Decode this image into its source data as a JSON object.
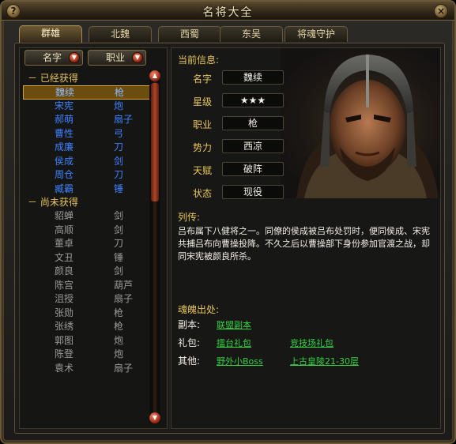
{
  "window": {
    "title": "名将大全"
  },
  "tabs": [
    {
      "label": "群雄",
      "active": true
    },
    {
      "label": "北魏",
      "active": false
    },
    {
      "label": "西蜀",
      "active": false
    },
    {
      "label": "东吴",
      "active": false
    },
    {
      "label": "将魂守护",
      "active": false
    }
  ],
  "sort": {
    "name_label": "名字",
    "job_label": "职业"
  },
  "list": {
    "owned_header": "已经获得",
    "owned": [
      {
        "name": "魏续",
        "weapon": "枪",
        "selected": true
      },
      {
        "name": "宋宪",
        "weapon": "炮"
      },
      {
        "name": "郝萌",
        "weapon": "扇子"
      },
      {
        "name": "曹性",
        "weapon": "弓"
      },
      {
        "name": "成廉",
        "weapon": "刀"
      },
      {
        "name": "侯成",
        "weapon": "剑"
      },
      {
        "name": "周仓",
        "weapon": "刀"
      },
      {
        "name": "臧霸",
        "weapon": "锤"
      }
    ],
    "not_owned_header": "尚未获得",
    "not_owned": [
      {
        "name": "貂蝉",
        "weapon": "剑"
      },
      {
        "name": "高顺",
        "weapon": "剑"
      },
      {
        "name": "董卓",
        "weapon": "刀"
      },
      {
        "name": "文丑",
        "weapon": "锤"
      },
      {
        "name": "颜良",
        "weapon": "剑"
      },
      {
        "name": "陈宫",
        "weapon": "葫芦"
      },
      {
        "name": "沮授",
        "weapon": "扇子"
      },
      {
        "name": "张勋",
        "weapon": "枪"
      },
      {
        "name": "张绣",
        "weapon": "枪"
      },
      {
        "name": "郭图",
        "weapon": "炮"
      },
      {
        "name": "陈登",
        "weapon": "炮"
      },
      {
        "name": "袁术",
        "weapon": "扇子"
      }
    ]
  },
  "info": {
    "current_label": "当前信息:",
    "attrs": [
      {
        "label": "名字",
        "value": "魏续"
      },
      {
        "label": "星级",
        "value": "★★★"
      },
      {
        "label": "职业",
        "value": "枪"
      },
      {
        "label": "势力",
        "value": "西凉"
      },
      {
        "label": "天赋",
        "value": "破阵"
      },
      {
        "label": "状态",
        "value": "现役"
      }
    ],
    "bio_label": "列传:",
    "bio": "吕布属下八健将之一。同僚的侯成被吕布处罚时，便同侯成、宋宪共捕吕布向曹操投降。不久之后以曹操部下身份参加官渡之战，却同宋宪被颜良所杀。",
    "source_label": "魂魄出处:",
    "sources": {
      "dungeon_label": "副本:",
      "dungeon_links": [
        "联盟副本"
      ],
      "gift_label": "礼包:",
      "gift_links": [
        "擂台礼包",
        "竞技场礼包"
      ],
      "other_label": "其他:",
      "other_links": [
        "野外小Boss",
        "上古皇陵21-30层"
      ]
    }
  },
  "colors": {
    "gold": "#e8c55a",
    "owned_blue": "#3f82ff",
    "link_green": "#35d143"
  }
}
